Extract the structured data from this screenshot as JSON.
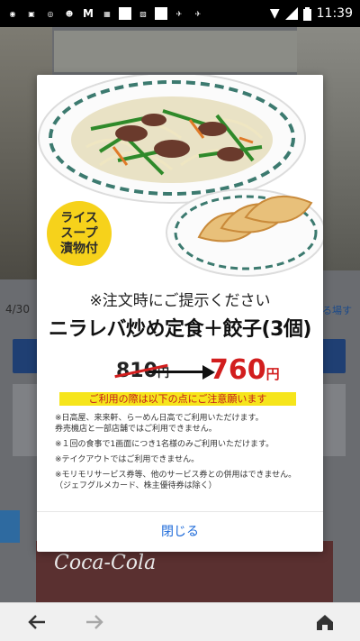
{
  "status_bar": {
    "time": "11:39",
    "left_icons": [
      "gusto-icon",
      "bag-icon",
      "clock-icon",
      "face-icon",
      "mcdonalds-icon",
      "grid-icon",
      "blank-icon",
      "photo-icon",
      "blank-icon",
      "bird-icon",
      "bird-icon"
    ]
  },
  "background": {
    "date_text": "4/30",
    "link_text": "る場す",
    "brand_text": "Coca-Cola"
  },
  "coupon": {
    "tag_lines": [
      "ライス",
      "スープ",
      "漬物付"
    ],
    "notice": "※注文時にご提示ください",
    "title": "ニラレバ炒め定食＋餃子(3個)",
    "old_price": "810",
    "new_price": "760",
    "yen": "円",
    "caution": "ご利用の際は以下の点にご注意願います",
    "terms": [
      "※日高屋、来来軒、らーめん日高でご利用いただけます。\n券売機店と一部店舗ではご利用できません。",
      "※１回の食事で1画面につき1名様のみご利用いただけます。",
      "※テイクアウトではご利用できません。",
      "※モリモリサービス券等、他のサービス券との併用はできません。\n（ジェフグルメカード、株主優待券は除く）"
    ],
    "close_label": "閉じる"
  },
  "colors": {
    "accent_blue": "#1d6ad9",
    "price_red": "#d21e1e",
    "badge_yellow": "#f6d21b"
  }
}
